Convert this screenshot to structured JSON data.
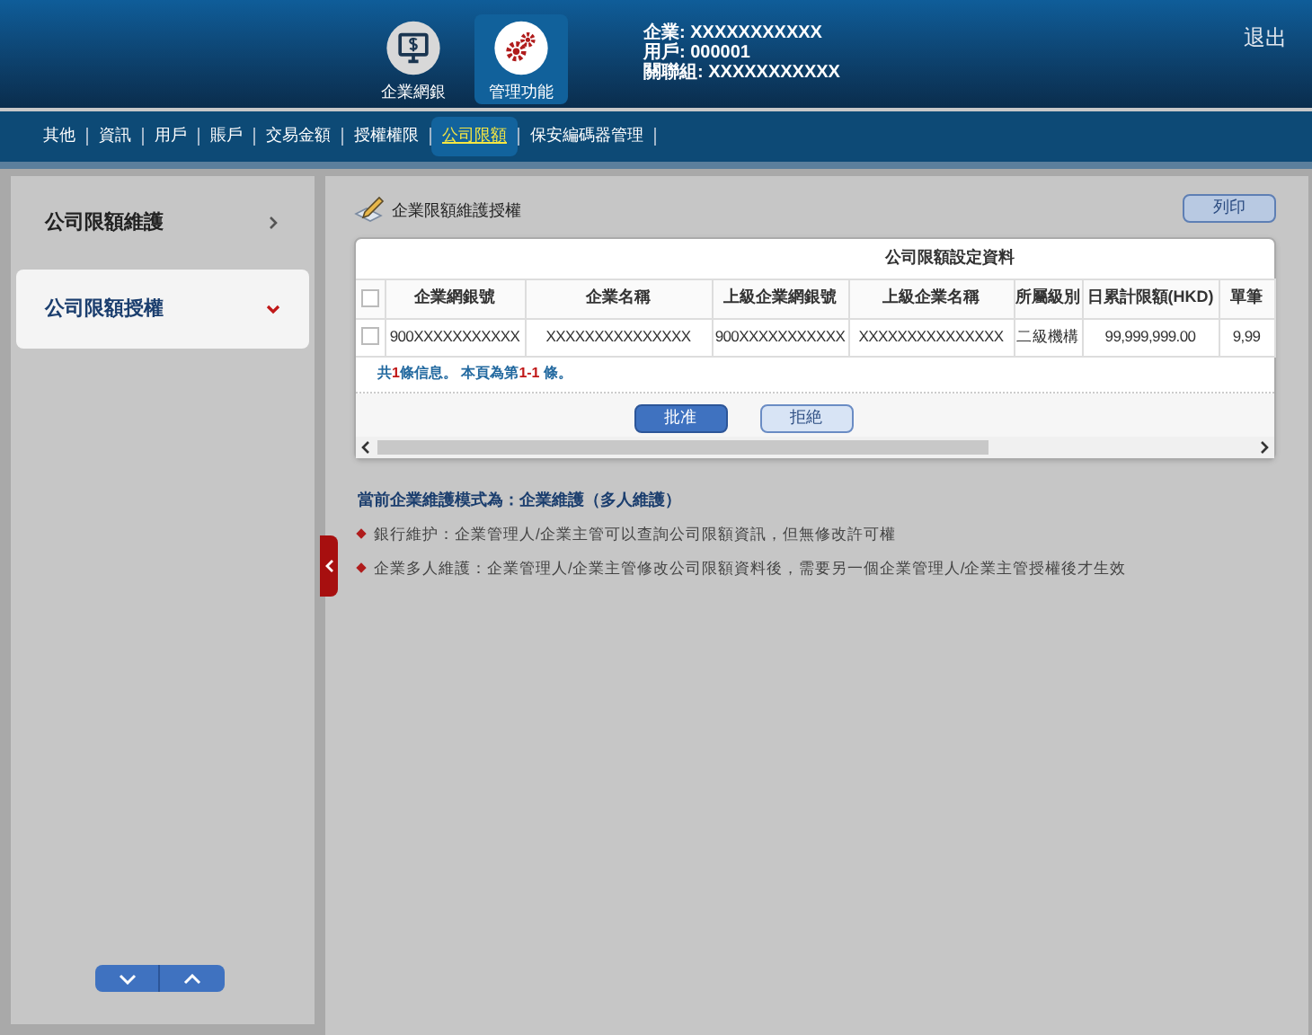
{
  "header": {
    "apps": [
      {
        "label": "企業網銀",
        "kind": "monitor",
        "selected": false
      },
      {
        "label": "管理功能",
        "kind": "gears",
        "selected": true
      }
    ],
    "info": [
      "企業: XXXXXXXXXXX",
      "用戶: 000001",
      "關聯組: XXXXXXXXXXX"
    ],
    "logout": "退出"
  },
  "nav": [
    {
      "label": "其他",
      "selected": false
    },
    {
      "label": "資訊",
      "selected": false
    },
    {
      "label": "用戶",
      "selected": false
    },
    {
      "label": "賬戶",
      "selected": false
    },
    {
      "label": "交易金額",
      "selected": false
    },
    {
      "label": "授權權限",
      "selected": false
    },
    {
      "label": "公司限額",
      "selected": true
    },
    {
      "label": "保安編碼器管理",
      "selected": false
    }
  ],
  "sidebar": {
    "items": [
      {
        "label": "公司限額維護",
        "expanded": false
      },
      {
        "label": "公司限額授權",
        "expanded": true
      }
    ]
  },
  "page": {
    "title": "企業限額維護授權",
    "print_button": "列印",
    "table": {
      "group_heading": "公司限額設定資料",
      "select_all_checked": false,
      "columns": [
        "企業網銀號",
        "企業名稱",
        "上級企業網銀號",
        "上級企業名稱",
        "所屬級別",
        "日累計限額(HKD)",
        "單筆"
      ],
      "rows": [
        {
          "checked": false,
          "cells": [
            "900XXXXXXXXXXX",
            "XXXXXXXXXXXXXXX",
            "900XXXXXXXXXXX",
            "XXXXXXXXXXXXXXX",
            "二級機構",
            "99,999,999.00",
            "9,99"
          ]
        }
      ],
      "summary": {
        "prefix": "共",
        "count": "1",
        "middle": "條信息。 本頁為第",
        "range": "1-1",
        "suffix": " 條。"
      }
    },
    "actions": [
      {
        "label": "批准",
        "kind": "primary"
      },
      {
        "label": "拒絶",
        "kind": "secondary"
      }
    ],
    "mode_note": "當前企業維護模式為：企業維護（多人維護）",
    "notes": [
      "銀行維护：企業管理人/企業主管可以查詢公司限額資訊，但無修改許可權",
      "企業多人維護：企業管理人/企業主管修改公司限額資料後，需要另一個企業管理人/企業主管授權後才生效"
    ]
  }
}
